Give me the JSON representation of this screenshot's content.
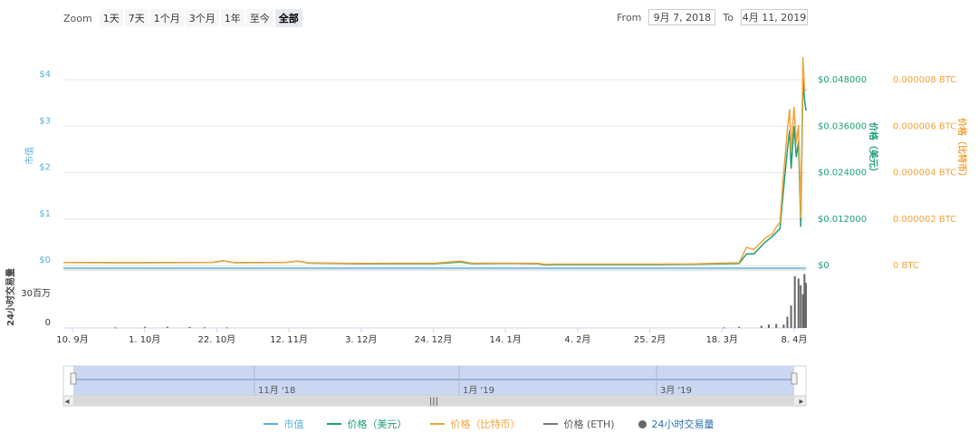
{
  "toolbar": {
    "zoom_label": "Zoom",
    "zoom_buttons": [
      "1天",
      "7天",
      "1个月",
      "3个月",
      "1年",
      "至今",
      "全部"
    ],
    "zoom_active": 6,
    "from_label": "From",
    "from_value": "9月 7, 2018",
    "to_label": "To",
    "to_value": "4月 11, 2019"
  },
  "colors": {
    "market_cap": "#5ab0e0",
    "price_usd": "#1b9e77",
    "price_btc": "#f2a33a",
    "price_eth": "#777777",
    "volume": "#666666"
  },
  "chart_data": {
    "type": "line",
    "x_tick_labels": [
      "10. 9月",
      "1. 10月",
      "22. 10月",
      "12. 11月",
      "3. 12月",
      "24. 12月",
      "14. 1月",
      "4. 2月",
      "25. 2月",
      "18. 3月",
      "8. 4月"
    ],
    "y_axis_market_cap": {
      "label": "市值",
      "ticks": [
        "$0",
        "$1",
        "$2",
        "$3",
        "$4"
      ],
      "range": [
        0,
        4
      ]
    },
    "y_axis_price_usd": {
      "label": "价格（美元）",
      "ticks": [
        "$0",
        "$0.012000",
        "$0.024000",
        "$0.036000",
        "$0.048000"
      ],
      "range": [
        0,
        0.048
      ]
    },
    "y_axis_price_btc": {
      "label": "价格（比特币）",
      "ticks": [
        "0 BTC",
        "0.000002 BTC",
        "0.000004 BTC",
        "0.000006 BTC",
        "0.000008 BTC"
      ],
      "range": [
        0,
        8e-06
      ]
    },
    "y_axis_volume": {
      "label": "24小时交易量",
      "ticks": [
        "0",
        "30百万"
      ]
    },
    "series": [
      {
        "name": "市值",
        "color": "#5ab0e0",
        "points": [
          [
            0,
            0
          ],
          [
            100,
            0
          ]
        ]
      },
      {
        "name": "价格（美元）",
        "color": "#1b9e77",
        "points": [
          [
            0,
            0.00075
          ],
          [
            10,
            0.0007
          ],
          [
            20,
            0.00075
          ],
          [
            21.5,
            0.0012
          ],
          [
            23,
            0.0007
          ],
          [
            30,
            0.00075
          ],
          [
            31.5,
            0.0011
          ],
          [
            33,
            0.0006
          ],
          [
            40,
            0.0004
          ],
          [
            50,
            0.00045
          ],
          [
            53.5,
            0.0009
          ],
          [
            55,
            0.00045
          ],
          [
            60,
            0.0005
          ],
          [
            64,
            0.0004
          ],
          [
            65,
            0.0001
          ],
          [
            66,
            0.0002
          ],
          [
            70,
            0.0002
          ],
          [
            80,
            0.0002
          ],
          [
            85,
            0.0003
          ],
          [
            91,
            0.0005
          ],
          [
            92,
            0.003
          ],
          [
            93,
            0.003
          ],
          [
            94.5,
            0.006
          ],
          [
            95.5,
            0.0075
          ],
          [
            96,
            0.0085
          ],
          [
            96.5,
            0.0095
          ],
          [
            97,
            0.02
          ],
          [
            97.5,
            0.03
          ],
          [
            97.8,
            0.035
          ],
          [
            98,
            0.025
          ],
          [
            98.4,
            0.036
          ],
          [
            98.7,
            0.028
          ],
          [
            99,
            0.032
          ],
          [
            99.3,
            0.01
          ],
          [
            99.6,
            0.048
          ],
          [
            99.8,
            0.043
          ],
          [
            100,
            0.04
          ]
        ]
      },
      {
        "name": "价格（比特币）",
        "color": "#f2a33a",
        "points": [
          [
            0,
            0.00013
          ],
          [
            10,
            0.00012
          ],
          [
            20,
            0.00013
          ],
          [
            21.5,
            0.0002
          ],
          [
            23,
            0.00012
          ],
          [
            30,
            0.00013
          ],
          [
            31.5,
            0.00019
          ],
          [
            33,
            0.00012
          ],
          [
            40,
            9e-05
          ],
          [
            50,
            0.0001
          ],
          [
            53.5,
            0.00019
          ],
          [
            55,
            0.0001
          ],
          [
            60,
            0.0001
          ],
          [
            64,
            9e-05
          ],
          [
            65,
            4e-05
          ],
          [
            66,
            6e-05
          ],
          [
            70,
            6e-05
          ],
          [
            80,
            6e-05
          ],
          [
            85,
            7e-05
          ],
          [
            91,
            0.00012
          ],
          [
            92,
            0.0008
          ],
          [
            93,
            0.0007
          ],
          [
            94.5,
            0.0012
          ],
          [
            95.5,
            0.0014
          ],
          [
            96,
            0.0017
          ],
          [
            96.5,
            0.0019
          ],
          [
            97,
            0.0041
          ],
          [
            97.5,
            0.006
          ],
          [
            97.8,
            0.0069
          ],
          [
            98,
            0.005
          ],
          [
            98.4,
            0.007
          ],
          [
            98.7,
            0.0054
          ],
          [
            99,
            0.0062
          ],
          [
            99.3,
            0.0021
          ],
          [
            99.6,
            0.0092
          ],
          [
            99.8,
            0.0078
          ],
          [
            100,
            0.0077
          ]
        ]
      },
      {
        "name": "价格 (ETH)",
        "color": "#777777",
        "points": []
      },
      {
        "name": "24小时交易量",
        "color": "#666666",
        "points": [
          [
            7,
            0.5
          ],
          [
            11,
            1
          ],
          [
            14,
            1
          ],
          [
            17,
            0.8
          ],
          [
            19,
            0.6
          ],
          [
            22,
            0.5
          ],
          [
            89,
            0.5
          ],
          [
            91,
            1
          ],
          [
            94,
            2
          ],
          [
            95,
            3
          ],
          [
            96,
            3.5
          ],
          [
            97,
            3
          ],
          [
            97.5,
            10
          ],
          [
            98,
            20
          ],
          [
            98.5,
            46
          ],
          [
            99,
            44
          ],
          [
            99.3,
            38
          ],
          [
            99.6,
            30
          ],
          [
            99.8,
            48
          ],
          [
            100,
            40
          ]
        ]
      }
    ]
  },
  "navigator": {
    "labels": [
      "11月 '18",
      "1月 '19",
      "3月 '19"
    ],
    "scrollbar_left": "◂",
    "scrollbar_right": "▸",
    "scrollbar_grip": "|||"
  },
  "legend": {
    "items": [
      {
        "label": "市值",
        "color": "#5ab0e0",
        "kind": "line"
      },
      {
        "label": "价格（美元）",
        "color": "#1b9e77",
        "kind": "line"
      },
      {
        "label": "价格（比特币）",
        "color": "#f2a33a",
        "kind": "line"
      },
      {
        "label": "价格 (ETH)",
        "color": "#777777",
        "kind": "line"
      },
      {
        "label": "24小时交易量",
        "color": "#666666",
        "kind": "dot"
      }
    ]
  }
}
